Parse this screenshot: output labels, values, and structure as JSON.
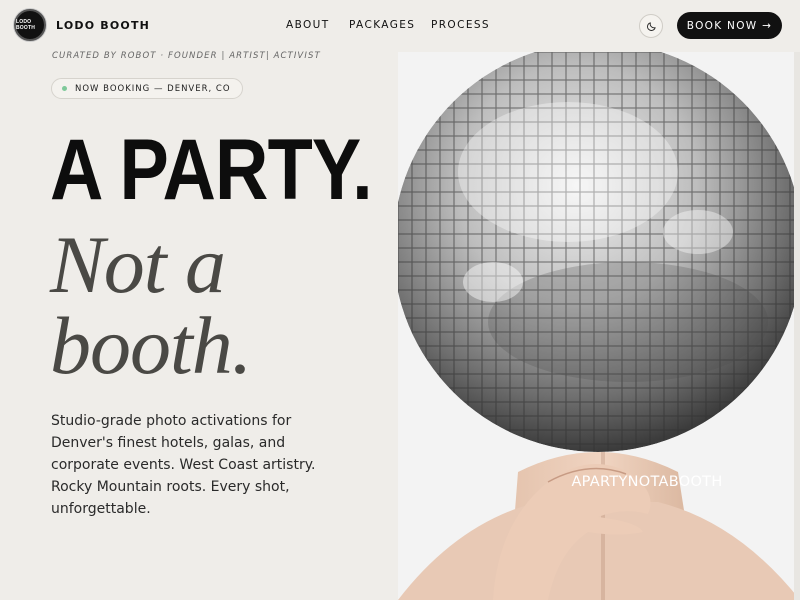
{
  "nav": {
    "logo_text": "LODO BOOTH",
    "brand_name": "LODO BOOTH",
    "links": [
      {
        "label": "ABOUT"
      },
      {
        "label": "PACKAGES"
      },
      {
        "label": "PROCESS"
      }
    ],
    "theme_icon": "moon-icon",
    "cta_label": "BOOK NOW →"
  },
  "hero": {
    "curated": "CURATED BY ROBOT · FOUNDER | ARTIST| ACTIVIST",
    "status_pill": "NOW BOOKING — DENVER, CO",
    "status_color": "#7fc99a",
    "headline": "A PARTY.",
    "subheadline_line1": "Not a",
    "subheadline_line2": "booth.",
    "lede": "Studio-grade photo activations for Denver's finest hotels, galas, and corporate events. West Coast artistry. Rocky Mountain roots. Every shot, unforgettable."
  },
  "media": {
    "image_name": "disco-ball-head-photo",
    "watermark": "APARTYNOTABOOTH"
  },
  "colors": {
    "background": "#efede9",
    "ink": "#0d0d0d",
    "accent_dark": "#111111"
  }
}
